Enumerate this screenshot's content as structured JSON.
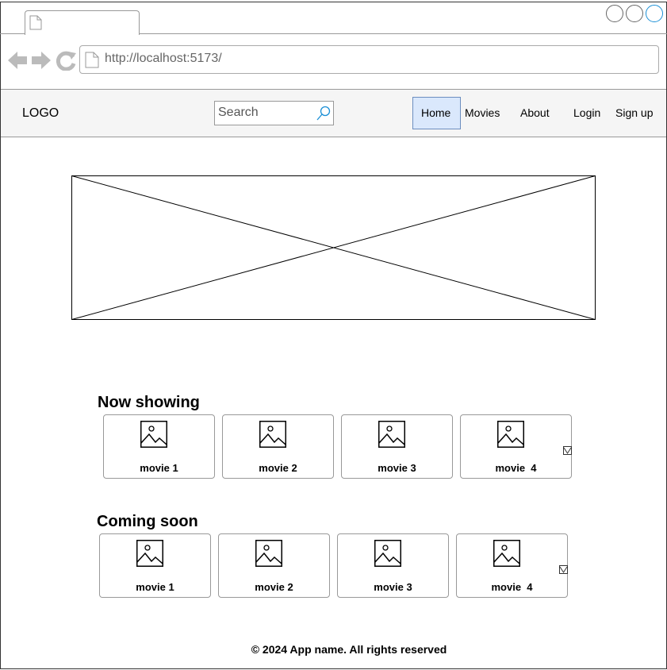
{
  "browser": {
    "url": "http://localhost:5173/",
    "icons": [
      "page-icon",
      "back-arrow-icon",
      "forward-arrow-icon",
      "reload-icon",
      "window-circle-icon"
    ]
  },
  "header": {
    "logo": "LOGO",
    "search_placeholder": "Search",
    "nav": {
      "home": "Home",
      "movies": "Movies",
      "about": "About",
      "login": "Login",
      "signup": "Sign up"
    },
    "active_nav": "Home",
    "active_color": "#dae8fc"
  },
  "now_showing": {
    "title": "Now showing",
    "movies": [
      "movie 1",
      "movie 2",
      "movie 3",
      "movie  4"
    ]
  },
  "coming_soon": {
    "title": "Coming soon",
    "movies": [
      "movie 1",
      "movie 2",
      "movie 3",
      "movie  4"
    ]
  },
  "footer": {
    "text": "© 2024 App name. All rights reserved"
  }
}
